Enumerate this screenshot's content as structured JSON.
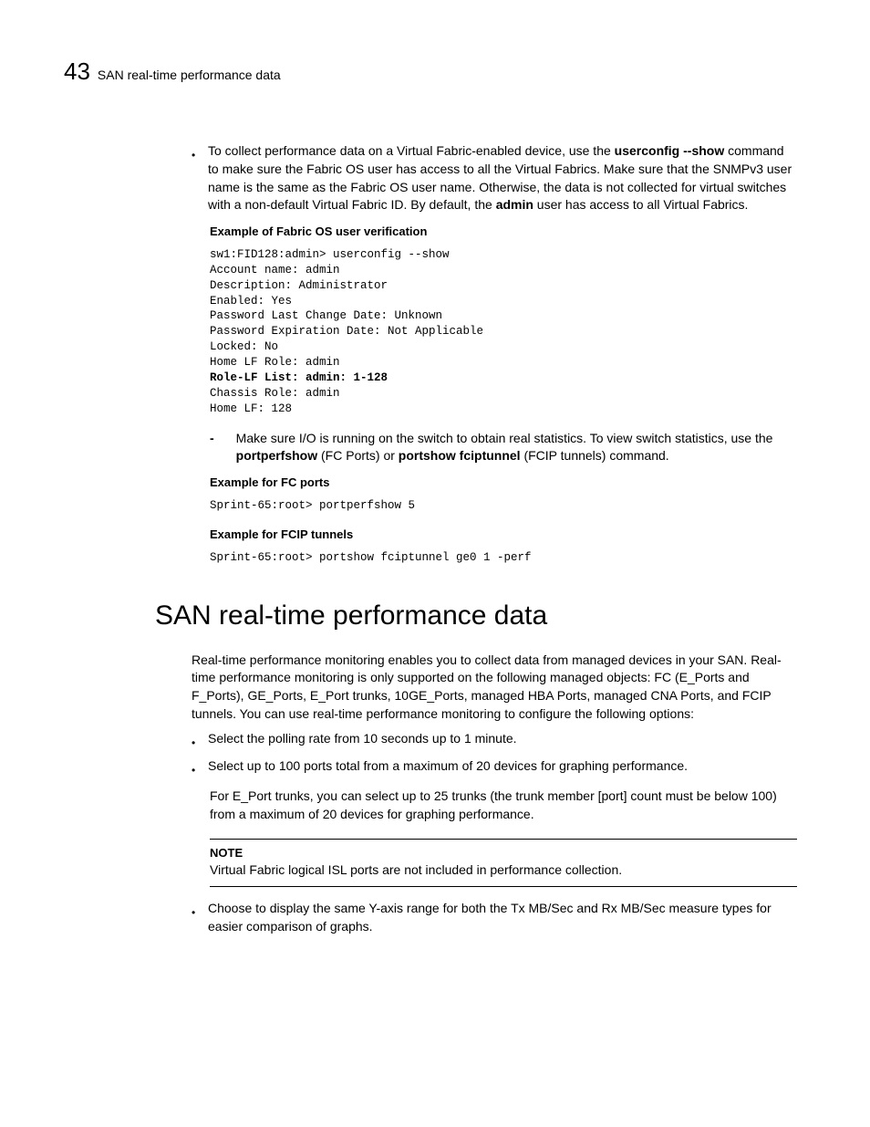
{
  "header": {
    "chapter_num": "43",
    "chapter_title": "SAN real-time performance data"
  },
  "b1": {
    "pre": "To collect performance data on a Virtual Fabric-enabled device, use the ",
    "cmd": "userconfig --show",
    "rest": " command to make sure the Fabric OS user has access to all the Virtual Fabrics. Make sure that the SNMPv3 user name is the same as the Fabric OS user name. Otherwise, the data is not collected for virtual switches with a non-default Virtual Fabric ID. By default, the ",
    "admin": "admin",
    "rest2": " user has access to all Virtual Fabrics."
  },
  "ex_fabric_label": "Example of Fabric OS user verification",
  "mono1_a": "sw1:FID128:admin> userconfig --show\nAccount name: admin\nDescription: Administrator\nEnabled: Yes\nPassword Last Change Date: Unknown\nPassword Expiration Date: Not Applicable\nLocked: No\nHome LF Role: admin",
  "mono1_bold": "Role-LF List: admin: 1-128",
  "mono1_b": "Chassis Role: admin\nHome LF: 128",
  "dash": {
    "pre": "Make sure I/O is running on the switch to obtain real statistics. To view switch statistics, use the ",
    "cmd1": "portperfshow",
    "mid": "  (FC Ports) or ",
    "cmd2": "portshow fciptunnel",
    "post": "  (FCIP tunnels) command."
  },
  "ex_fc_label": "Example for FC ports",
  "mono2": "Sprint-65:root> portperfshow 5",
  "ex_fcip_label": "Example for FCIP tunnels",
  "mono3": "Sprint-65:root> portshow fciptunnel ge0 1 -perf",
  "h1": "SAN real-time performance data",
  "intro": "Real-time performance monitoring enables you to collect data from managed devices in your SAN. Real-time performance monitoring is only supported on the following managed objects: FC (E_Ports and F_Ports), GE_Ports, E_Port trunks, 10GE_Ports, managed HBA Ports, managed CNA Ports, and FCIP tunnels. You can use real-time performance monitoring to configure the following options:",
  "opt1": "Select the polling rate from 10 seconds up to 1 minute.",
  "opt2": "Select up to 100 ports total from a maximum of 20 devices for graphing performance.",
  "opt2_sub": "For E_Port trunks, you can select up to 25 trunks (the trunk member [port] count must be below 100) from a maximum of 20 devices for graphing performance.",
  "note_label": "NOTE",
  "note_text": "Virtual Fabric logical ISL ports are not included in performance collection.",
  "opt3": "Choose to display the same Y-axis range for both the Tx MB/Sec and Rx MB/Sec measure types for easier comparison of graphs."
}
